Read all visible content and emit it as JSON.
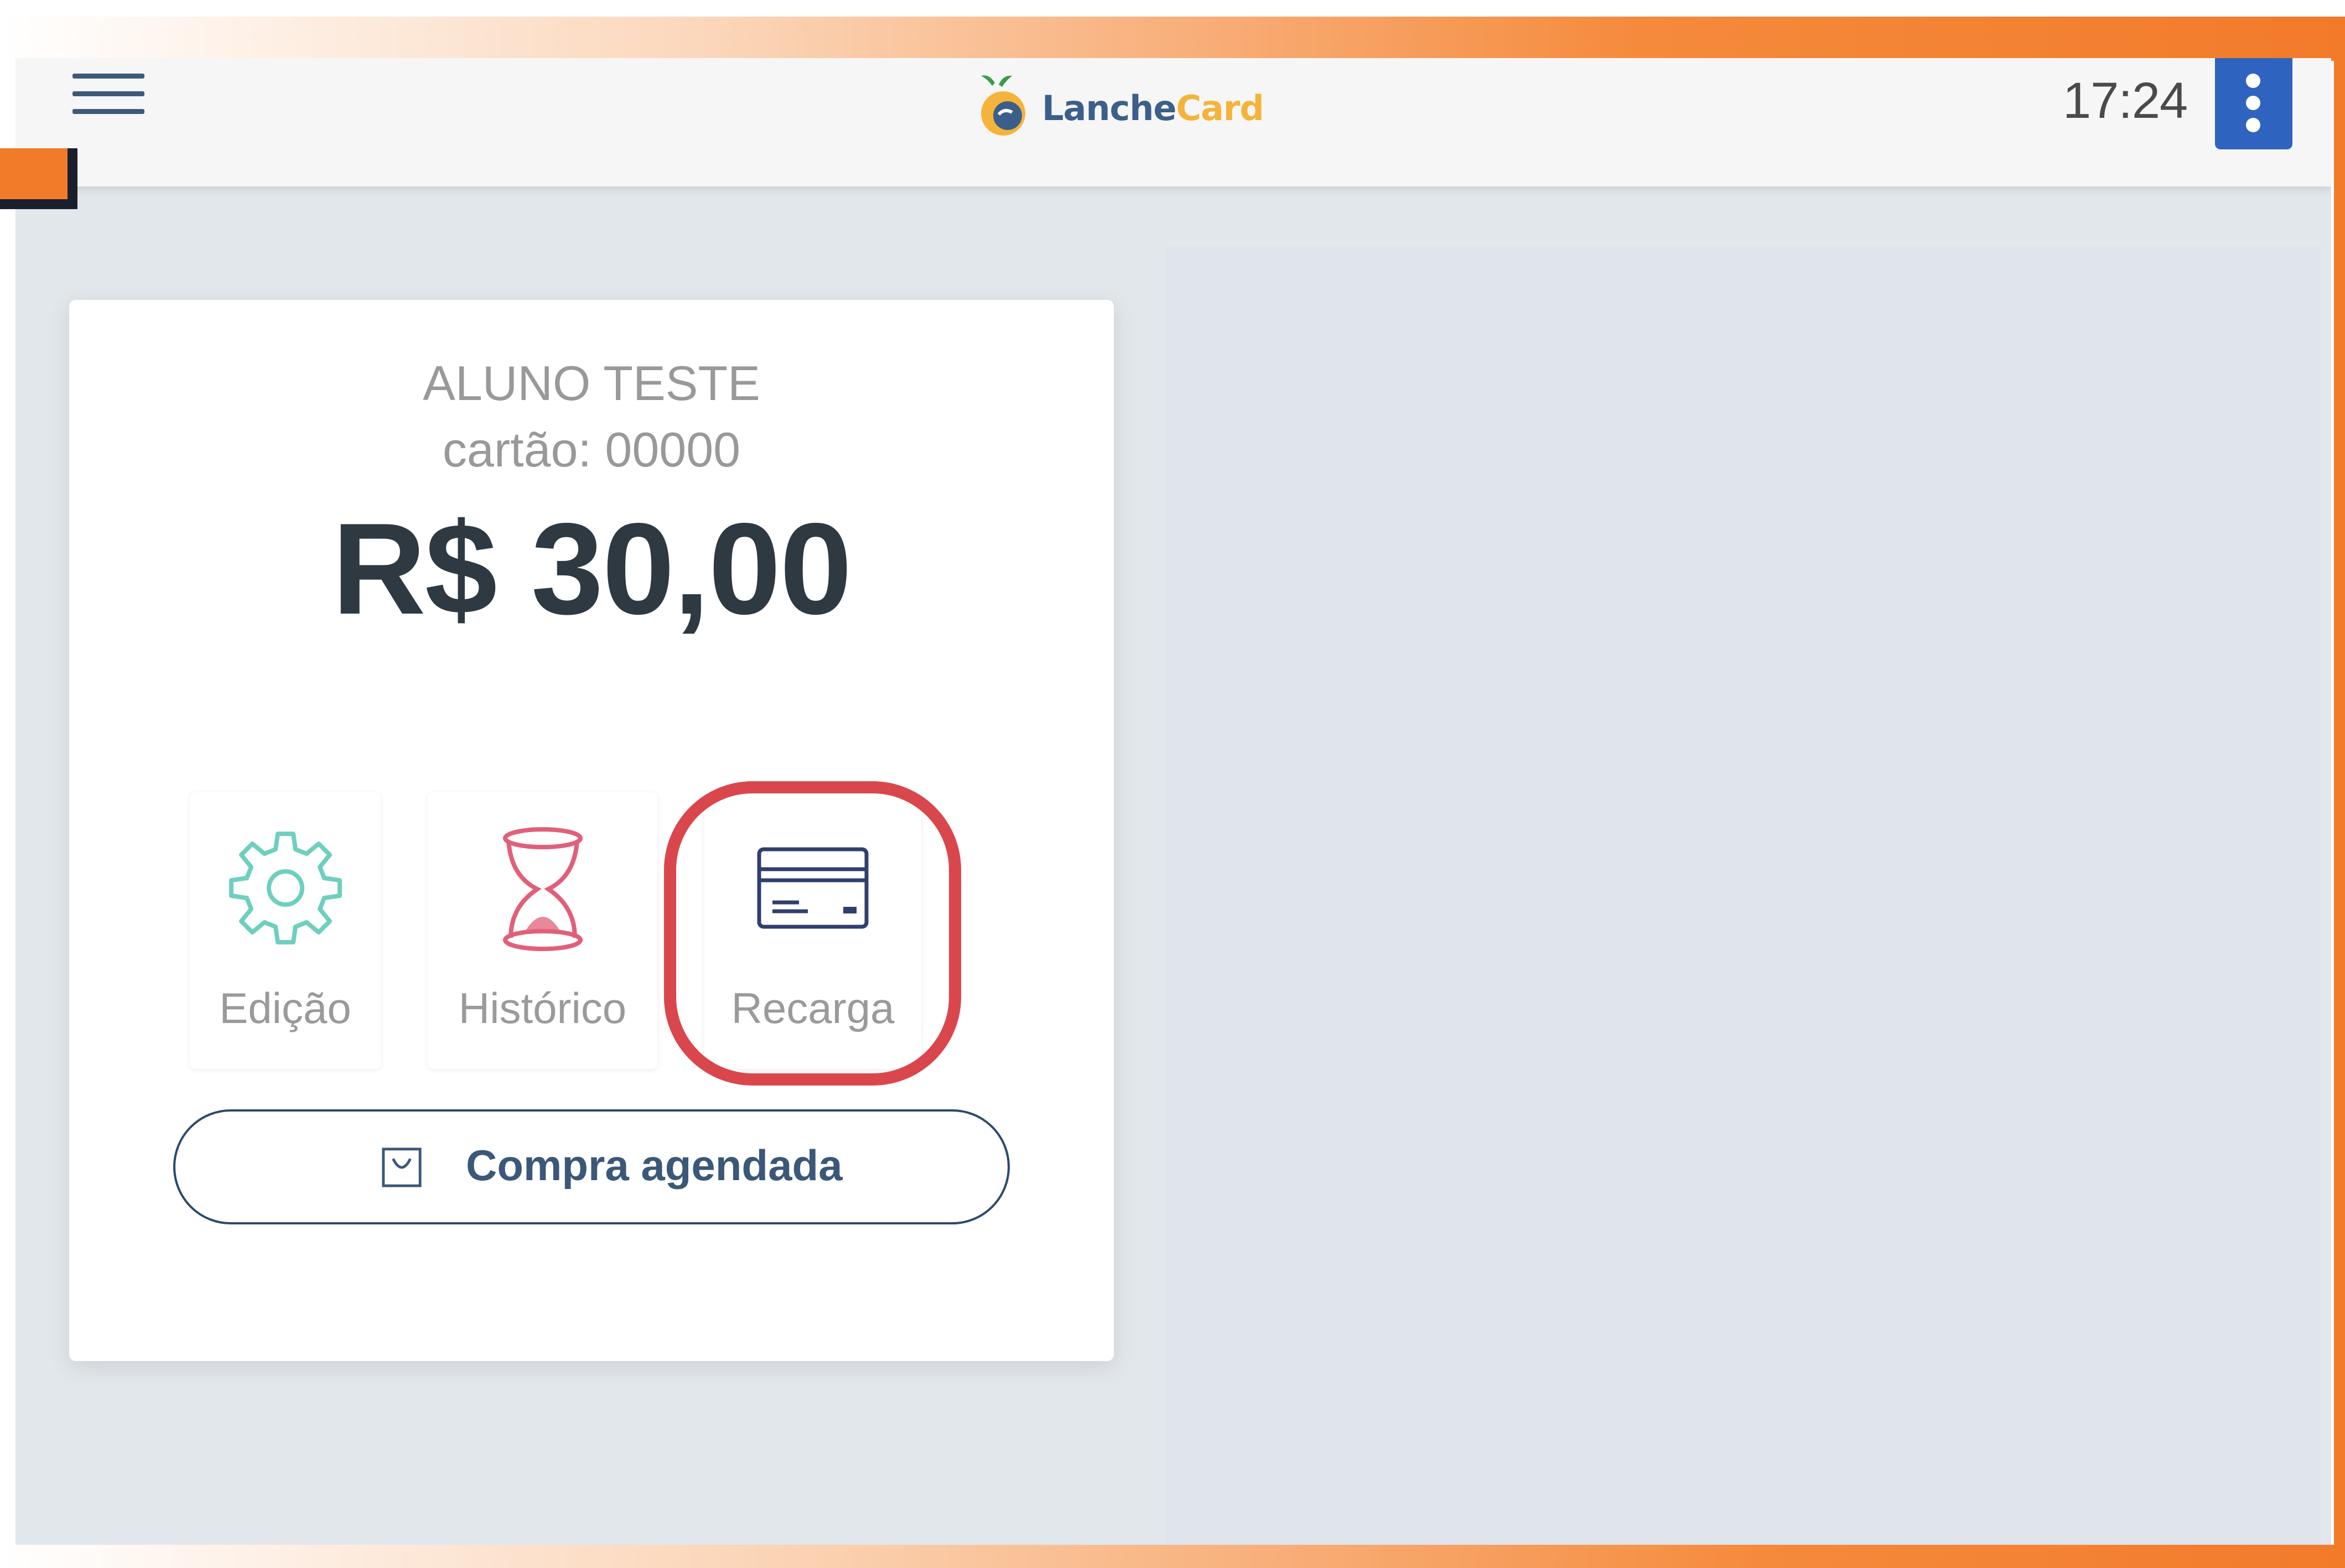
{
  "header": {
    "logo_part1": "Lanche",
    "logo_part2": "Card",
    "time": "17:24"
  },
  "card": {
    "student_name": "ALUNO TESTE",
    "card_number": "cartão: 00000",
    "balance": "R$ 30,00",
    "actions": [
      {
        "label": "Edição",
        "icon": "gear-icon",
        "color": "#6fcfbf"
      },
      {
        "label": "Histórico",
        "icon": "hourglass-icon",
        "color": "#e0607a"
      },
      {
        "label": "Recarga",
        "icon": "credit-card-icon",
        "color": "#2f3f6f"
      }
    ],
    "schedule_button": "Compra agendada"
  },
  "colors": {
    "accent_orange": "#f27b2a",
    "primary_blue": "#2f63c0",
    "highlight_red": "#d9474c",
    "balance_text": "#2e3942"
  }
}
